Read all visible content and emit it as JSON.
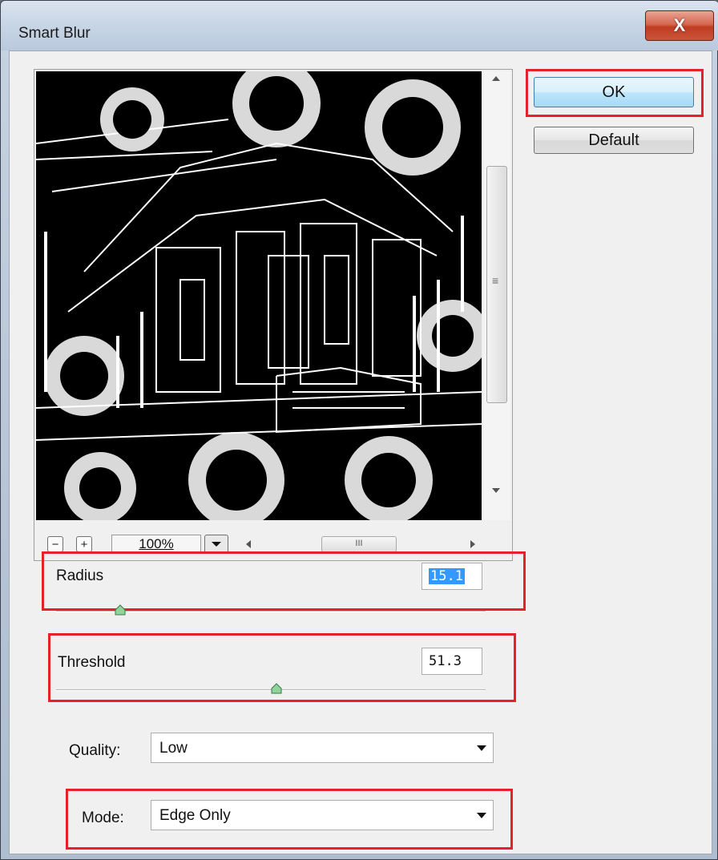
{
  "window": {
    "title": "Smart Blur",
    "close_glyph": "X"
  },
  "buttons": {
    "ok_label": "OK",
    "default_label": "Default"
  },
  "preview": {
    "zoom_out_glyph": "−",
    "zoom_in_glyph": "+",
    "zoom_level": "100%",
    "hscroll_grip": "III",
    "vscroll_grip": "≡"
  },
  "radius": {
    "label": "Radius",
    "value": "15.1",
    "level": 0.15
  },
  "threshold": {
    "label": "Threshold",
    "value": "51.3",
    "level": 0.513
  },
  "quality": {
    "label": "Quality:",
    "selected": "Low"
  },
  "mode": {
    "label": "Mode:",
    "selected": "Edge Only"
  },
  "colors": {
    "highlight": "#e8202a",
    "selection": "#3399ff"
  }
}
